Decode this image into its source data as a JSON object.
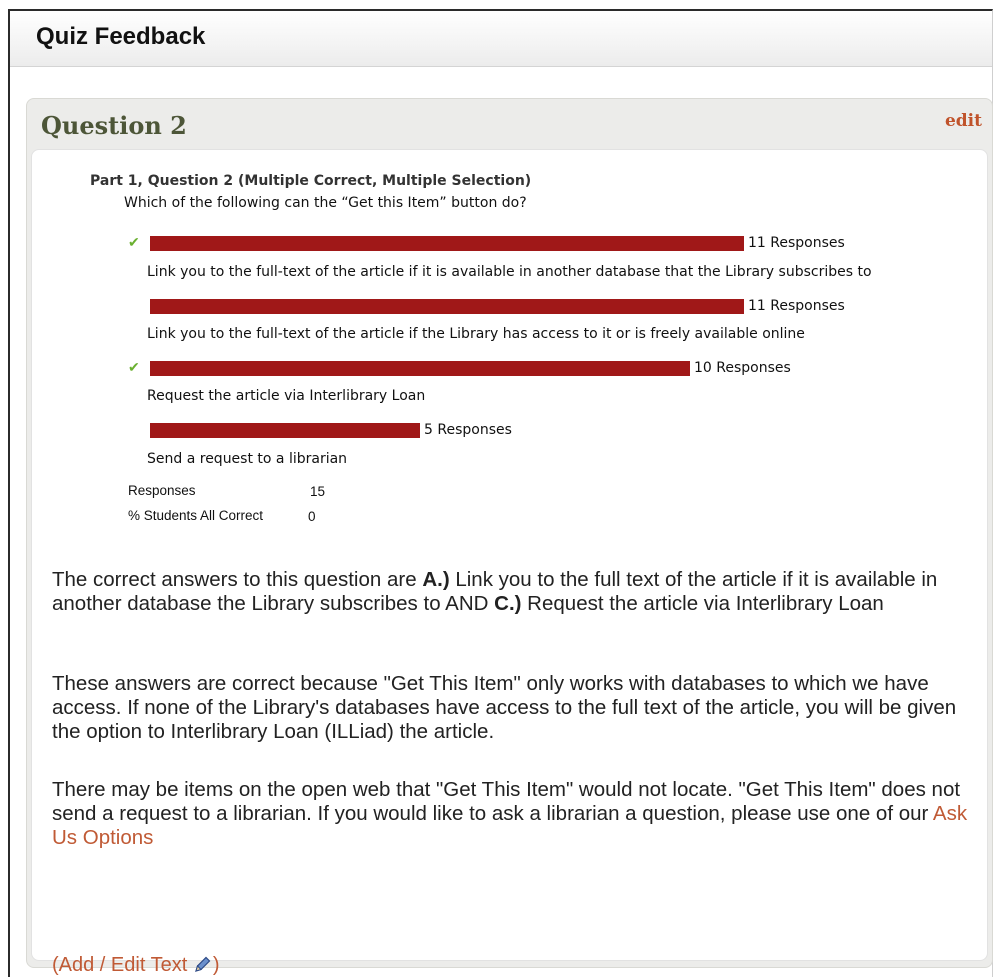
{
  "window": {
    "title": "Quiz Feedback"
  },
  "panel": {
    "title": "Question 2",
    "edit_label": "edit"
  },
  "question": {
    "header": "Part 1, Question 2 (Multiple Correct, Multiple Selection)",
    "prompt": "Which of the following can the “Get this Item” button do?",
    "options": [
      {
        "correct": true,
        "responses": 11,
        "responses_label": "11 Responses",
        "text": "Link you to the full-text of the article if it is available in another database that the Library subscribes to"
      },
      {
        "correct": false,
        "responses": 11,
        "responses_label": "11 Responses",
        "text": "Link you to the full-text of the article if the Library has access to it or is freely available online"
      },
      {
        "correct": true,
        "responses": 10,
        "responses_label": "10 Responses",
        "text": "Request the article via Interlibrary Loan"
      },
      {
        "correct": false,
        "responses": 5,
        "responses_label": "5 Responses",
        "text": "Send a request to a librarian"
      }
    ],
    "stats": {
      "responses_label": "Responses",
      "responses_value": "15",
      "correct_label": "% Students All Correct",
      "correct_value": "0"
    }
  },
  "feedback": {
    "p1_a": "The correct answers to this question are ",
    "p1_b": "A.)",
    "p1_c": " Link you to the full text of the article if it is available in another database the Library subscribes to AND ",
    "p1_d": "C.)",
    "p1_e": " Request the article via Interlibrary Loan",
    "p2": "These answers are correct because \"Get This Item\" only works with databases to which we have access.  If none of the Library's databases have access to the full text of the article, you will be given the option to Interlibrary Loan (ILLiad) the article.",
    "p3": "There may be items on the open web that \"Get This Item\" would not locate.  \"Get This Item\" does not send a request to a librarian. If you would like to ask a librarian a question, please use one of our ",
    "p3_link": "Ask Us Options",
    "add_edit": "(Add / Edit Text",
    "add_edit_close": ")"
  },
  "colors": {
    "bar": "#a01818",
    "check": "#6ab030",
    "link": "#c05a35",
    "heading": "#4d5638"
  },
  "icons": {
    "check": "check-icon",
    "pencil": "pencil-icon"
  }
}
